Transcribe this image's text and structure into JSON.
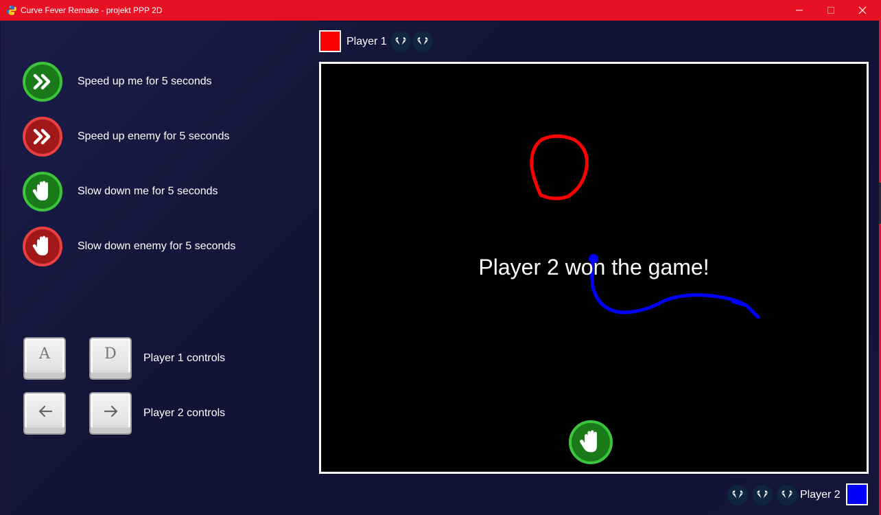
{
  "window": {
    "title": "Curve Fever Remake - projekt PPP 2D",
    "accent_color": "#e81123"
  },
  "powerups": [
    {
      "icon": "fast-forward-icon",
      "color": "green",
      "label": "Speed up me for 5 seconds"
    },
    {
      "icon": "fast-forward-icon",
      "color": "red",
      "label": "Speed up enemy for 5 seconds"
    },
    {
      "icon": "hand-icon",
      "color": "green",
      "label": "Slow down me for 5 seconds"
    },
    {
      "icon": "hand-icon",
      "color": "red",
      "label": "Slow down enemy for 5 seconds"
    }
  ],
  "controls": [
    {
      "keys": [
        "A",
        "D"
      ],
      "label": "Player 1 controls"
    },
    {
      "keys": [
        "left-arrow-icon",
        "right-arrow-icon"
      ],
      "label": "Player 2 controls"
    }
  ],
  "player1": {
    "name": "Player 1",
    "color": "#ff0000",
    "gems": 2
  },
  "player2": {
    "name": "Player 2",
    "color": "#0000ff",
    "gems": 3
  },
  "arena": {
    "message": "Player 2 won the game!",
    "active_powerup": "hand-icon"
  }
}
